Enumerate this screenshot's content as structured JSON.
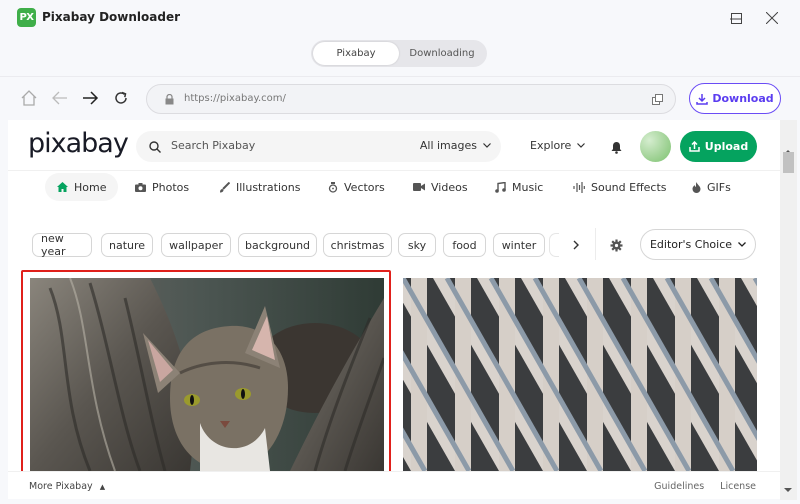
{
  "app": {
    "logo_text": "PX",
    "title": "Pixabay Downloader",
    "window_controls": [
      "minimize-icon",
      "maximize-icon",
      "close-icon"
    ]
  },
  "tabs": [
    {
      "label": "Pixabay",
      "active": true
    },
    {
      "label": "Downloading",
      "active": false
    }
  ],
  "browser": {
    "url": "https://pixabay.com/",
    "download_label": "Download",
    "nav_icons": [
      "home-icon",
      "back-icon",
      "forward-icon",
      "reload-icon"
    ]
  },
  "site": {
    "logo": "pixabay",
    "search_placeholder": "Search Pixabay",
    "search_filter": "All images",
    "explore_label": "Explore",
    "upload_label": "Upload",
    "categories": [
      {
        "label": "Home",
        "icon": "home-icon",
        "active": true
      },
      {
        "label": "Photos",
        "icon": "camera-icon"
      },
      {
        "label": "Illustrations",
        "icon": "brush-icon"
      },
      {
        "label": "Vectors",
        "icon": "pen-nib-icon"
      },
      {
        "label": "Videos",
        "icon": "video-icon"
      },
      {
        "label": "Music",
        "icon": "music-icon"
      },
      {
        "label": "Sound Effects",
        "icon": "waveform-icon"
      },
      {
        "label": "GIFs",
        "icon": "flame-icon"
      }
    ],
    "tags": [
      "new year",
      "nature",
      "wallpaper",
      "background",
      "christmas",
      "sky",
      "food",
      "winter"
    ],
    "sort_label": "Editor's Choice",
    "images": [
      {
        "subject": "tabby kitten between tree trunks",
        "selected": true
      },
      {
        "subject": "diagonal concrete building facade",
        "selected": false
      }
    ],
    "footer": {
      "more_label": "More Pixabay",
      "links": [
        "Guidelines",
        "License"
      ]
    }
  },
  "colors": {
    "brand_green": "#05a35f",
    "download_purple": "#5b3df0",
    "highlight_red": "#e0201b"
  }
}
